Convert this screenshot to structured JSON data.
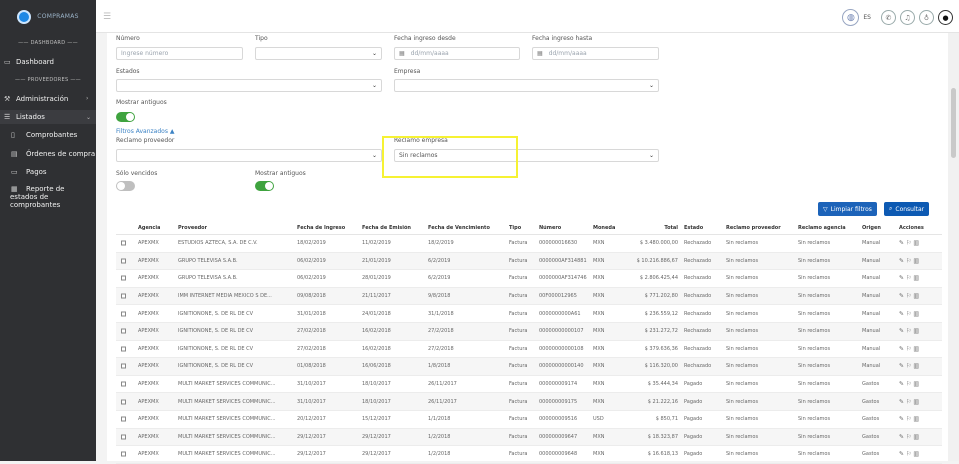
{
  "app": {
    "logo_text": "COMPRAMAS"
  },
  "sidebar": {
    "section_dashboard": "DASHBOARD",
    "dashboard": "Dashboard",
    "section_proveedores": "PROVEEDORES",
    "administracion": "Administración",
    "listados": "Listados",
    "comprobantes": "Comprobantes",
    "ordenes": "Órdenes de compra",
    "pagos": "Pagos",
    "reporte": "Reporte de estados de comprobantes"
  },
  "topbar": {
    "lang": "ES"
  },
  "filters": {
    "numero_label": "Número",
    "numero_placeholder": "Ingrese número",
    "tipo_label": "Tipo",
    "fecha_desde_label": "Fecha ingreso desde",
    "fecha_hasta_label": "Fecha ingreso hasta",
    "date_placeholder": "dd/mm/aaaa",
    "estados_label": "Estados",
    "empresa_label": "Empresa",
    "mostrar_antiguos_label": "Mostrar antiguos",
    "filtros_avanzados": "Filtros Avanzados",
    "reclamo_proveedor_label": "Reclamo proveedor",
    "reclamo_empresa_label": "Reclamo empresa",
    "reclamo_empresa_value": "Sin reclamos",
    "solo_vencidos_label": "Sólo vencidos",
    "mostrar_antiguos_label2": "Mostrar antiguos"
  },
  "buttons": {
    "limpiar": "Limpiar filtros",
    "consultar": "Consultar"
  },
  "table": {
    "headers": [
      "Agencia",
      "Proveedor",
      "Fecha de Ingreso",
      "Fecha de Emisión",
      "Fecha de Vencimiento",
      "Tipo",
      "Número",
      "Moneda",
      "Total",
      "Estado",
      "Reclamo proveedor",
      "Reclamo agencia",
      "Origen",
      "Acciones"
    ],
    "rows": [
      [
        "APEXMX",
        "ESTUDIOS AZTECA, S.A. DE C.V.",
        "18/02/2019",
        "11/02/2019",
        "18/2/2019",
        "Factura",
        "000000016630",
        "MXN",
        "$ 3.480.000,00",
        "Rechazado",
        "Sin reclamos",
        "Sin reclamos",
        "Manual"
      ],
      [
        "APEXMX",
        "GRUPO TELEVISA S.A.B.",
        "06/02/2019",
        "21/01/2019",
        "6/2/2019",
        "Factura",
        "0000000AF314881",
        "MXN",
        "$ 10.216.886,67",
        "Rechazado",
        "Sin reclamos",
        "Sin reclamos",
        "Manual"
      ],
      [
        "APEXMX",
        "GRUPO TELEVISA S.A.B.",
        "06/02/2019",
        "28/01/2019",
        "6/2/2019",
        "Factura",
        "0000000AF314746",
        "MXN",
        "$ 2.806.425,44",
        "Rechazado",
        "Sin reclamos",
        "Sin reclamos",
        "Manual"
      ],
      [
        "APEXMX",
        "IMM INTERNET MEDIA MEXICO S DE...",
        "09/08/2018",
        "21/11/2017",
        "9/8/2018",
        "Factura",
        "00F000012965",
        "MXN",
        "$ 771.202,80",
        "Rechazado",
        "Sin reclamos",
        "Sin reclamos",
        "Manual"
      ],
      [
        "APEXMX",
        "IGNITIONONE, S. DE RL DE CV",
        "31/01/2018",
        "24/01/2018",
        "31/1/2018",
        "Factura",
        "0000000000A61",
        "MXN",
        "$ 236.559,12",
        "Rechazado",
        "Sin reclamos",
        "Sin reclamos",
        "Manual"
      ],
      [
        "APEXMX",
        "IGNITIONONE, S. DE RL DE CV",
        "27/02/2018",
        "16/02/2018",
        "27/2/2018",
        "Factura",
        "00000000000107",
        "MXN",
        "$ 231.272,72",
        "Rechazado",
        "Sin reclamos",
        "Sin reclamos",
        "Manual"
      ],
      [
        "APEXMX",
        "IGNITIONONE, S. DE RL DE CV",
        "27/02/2018",
        "16/02/2018",
        "27/2/2018",
        "Factura",
        "00000000000108",
        "MXN",
        "$ 379.636,36",
        "Rechazado",
        "Sin reclamos",
        "Sin reclamos",
        "Manual"
      ],
      [
        "APEXMX",
        "IGNITIONONE, S. DE RL DE CV",
        "01/08/2018",
        "16/06/2018",
        "1/8/2018",
        "Factura",
        "00000000000140",
        "MXN",
        "$ 116.320,00",
        "Rechazado",
        "Sin reclamos",
        "Sin reclamos",
        "Manual"
      ],
      [
        "APEXMX",
        "MULTI MARKET SERVICES COMMUNIC...",
        "31/10/2017",
        "18/10/2017",
        "26/11/2017",
        "Factura",
        "000000009174",
        "MXN",
        "$ 35.444,34",
        "Pagado",
        "Sin reclamos",
        "Sin reclamos",
        "Gastos"
      ],
      [
        "APEXMX",
        "MULTI MARKET SERVICES COMMUNIC...",
        "31/10/2017",
        "18/10/2017",
        "26/11/2017",
        "Factura",
        "000000009175",
        "MXN",
        "$ 21.222,16",
        "Pagado",
        "Sin reclamos",
        "Sin reclamos",
        "Gastos"
      ],
      [
        "APEXMX",
        "MULTI MARKET SERVICES COMMUNIC...",
        "20/12/2017",
        "15/12/2017",
        "1/1/2018",
        "Factura",
        "000000009516",
        "USD",
        "$ 850,71",
        "Pagado",
        "Sin reclamos",
        "Sin reclamos",
        "Gastos"
      ],
      [
        "APEXMX",
        "MULTI MARKET SERVICES COMMUNIC...",
        "29/12/2017",
        "29/12/2017",
        "1/2/2018",
        "Factura",
        "000000009647",
        "MXN",
        "$ 18.323,87",
        "Pagado",
        "Sin reclamos",
        "Sin reclamos",
        "Gastos"
      ],
      [
        "APEXMX",
        "MULTI MARKET SERVICES COMMUNIC...",
        "29/12/2017",
        "29/12/2017",
        "1/2/2018",
        "Factura",
        "000000009648",
        "MXN",
        "$ 16.618,13",
        "Pagado",
        "Sin reclamos",
        "Sin reclamos",
        "Gastos"
      ]
    ]
  },
  "colors": {
    "accent": "#0d5ab3",
    "toggle_on": "#3fa33f",
    "highlight": "#f6f233"
  }
}
